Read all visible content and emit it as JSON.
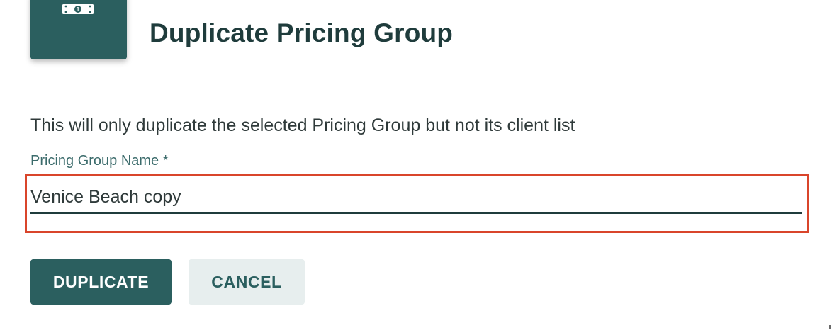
{
  "dialog": {
    "title": "Duplicate Pricing Group",
    "header_icon": "money-bill-icon",
    "helper_text": "This will only duplicate the selected Pricing Group but not its client list",
    "field": {
      "label": "Pricing Group Name *",
      "value": "Venice Beach copy"
    },
    "buttons": {
      "primary_label": "DUPLICATE",
      "secondary_label": "CANCEL"
    }
  },
  "colors": {
    "brand": "#2b5f5f",
    "title": "#1f3c3c",
    "highlight": "#d9452b",
    "secondary_button_bg": "#e7eeee"
  }
}
